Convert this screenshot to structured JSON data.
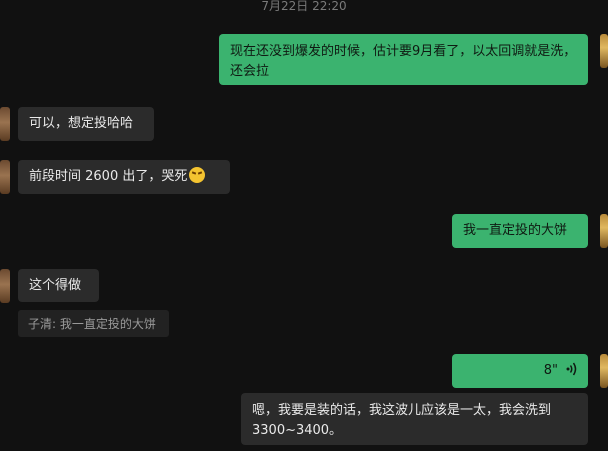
{
  "timestamp": "7月22日 22:20",
  "messages": [
    {
      "id": "m1",
      "side": "right",
      "text": "现在还没到爆发的时候，估计要9月看了，以太回调就是洗，还会拉"
    },
    {
      "id": "m2",
      "side": "left",
      "text": "可以，想定投哈哈"
    },
    {
      "id": "m3",
      "side": "left",
      "text": "前段时间 2600 出了，哭死",
      "emoji": "laughing-crying-emoji"
    },
    {
      "id": "m4",
      "side": "right",
      "text": "我一直定投的大饼"
    },
    {
      "id": "m5",
      "side": "left",
      "text": "这个得做",
      "quote": "子清: 我一直定投的大饼"
    },
    {
      "id": "m6",
      "side": "right",
      "type": "voice",
      "duration": "8\""
    },
    {
      "id": "m7",
      "side": "left",
      "text": "嗯，我要是装的话，我这波儿应该是一太，我会洗到3300~3400。"
    }
  ],
  "colors": {
    "background": "#111111",
    "sent_bubble": "#3bb36f",
    "received_bubble": "#2b2b2b"
  }
}
